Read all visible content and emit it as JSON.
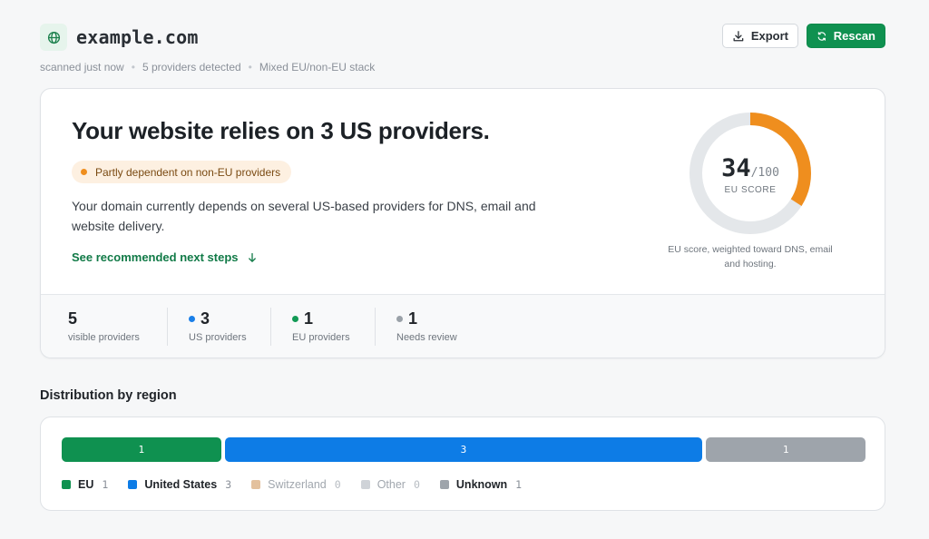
{
  "header": {
    "domain": "example.com",
    "meta": [
      "scanned just now",
      "5 providers detected",
      "Mixed EU/non-EU stack"
    ],
    "export_label": "Export",
    "rescan_label": "Rescan"
  },
  "summary": {
    "headline": "Your website relies on 3 US providers.",
    "badge": "Partly dependent on non-EU providers",
    "description": "Your domain currently depends on several US-based providers for DNS, email and website delivery.",
    "next_steps_label": "See recommended next steps",
    "score": {
      "value": "34",
      "max": "/100",
      "label": "EU SCORE",
      "fraction": 0.34,
      "caption": "EU score, weighted toward DNS, email and hosting."
    }
  },
  "stats": [
    {
      "value": "5",
      "label": "visible providers",
      "dot": null
    },
    {
      "value": "3",
      "label": "US providers",
      "dot": "#1a7fe8"
    },
    {
      "value": "1",
      "label": "EU providers",
      "dot": "#129a55"
    },
    {
      "value": "1",
      "label": "Needs review",
      "dot": "#9aa1a8"
    }
  ],
  "distribution": {
    "title": "Distribution by region",
    "segments": [
      {
        "region": "EU",
        "count": 1,
        "label": "1",
        "color": "#0f9150"
      },
      {
        "region": "United States",
        "count": 3,
        "label": "3",
        "color": "#0d7ce6"
      },
      {
        "region": "Unknown",
        "count": 1,
        "label": "1",
        "color": "#9ea4ab"
      }
    ],
    "legend": [
      {
        "name": "EU",
        "count": "1",
        "color": "#0f9150",
        "muted": false
      },
      {
        "name": "United States",
        "count": "3",
        "color": "#0d7ce6",
        "muted": false
      },
      {
        "name": "Switzerland",
        "count": "0",
        "color": "#e3c19e",
        "muted": true
      },
      {
        "name": "Other",
        "count": "0",
        "color": "#cfd3d8",
        "muted": true
      },
      {
        "name": "Unknown",
        "count": "1",
        "color": "#9ea4ab",
        "muted": false
      }
    ]
  },
  "colors": {
    "accent": "#0f9150",
    "gauge_fill": "#ef8e1e",
    "gauge_track": "#e4e7ea"
  }
}
